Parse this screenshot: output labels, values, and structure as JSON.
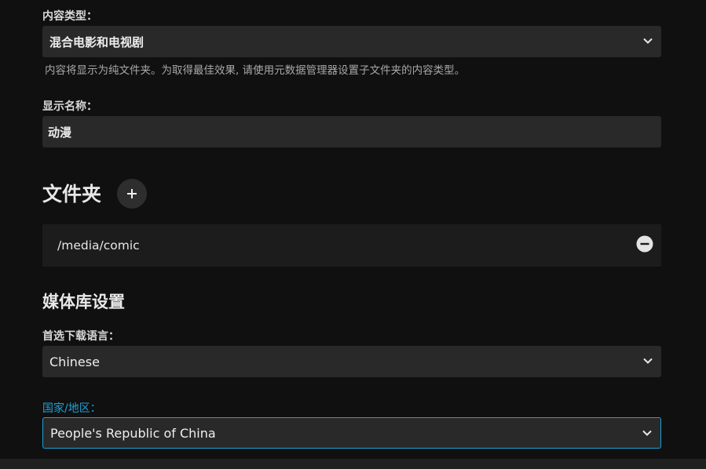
{
  "content_type": {
    "label": "内容类型：",
    "value": "混合电影和电视剧",
    "help": "内容将显示为纯文件夹。为取得最佳效果, 请使用元数据管理器设置子文件夹的内容类型。"
  },
  "display_name": {
    "label": "显示名称：",
    "value": "动漫"
  },
  "folders": {
    "title": "文件夹",
    "add_icon": "plus-icon",
    "items": [
      {
        "path": "/media/comic",
        "remove_icon": "minus-circle-icon"
      }
    ]
  },
  "library_settings": {
    "title": "媒体库设置",
    "language": {
      "label": "首选下载语言：",
      "value": "Chinese"
    },
    "country": {
      "label": "国家/地区：",
      "value": "People's Republic of China"
    }
  },
  "colors": {
    "background": "#101010",
    "field": "#292929",
    "accent": "#1ea0d8"
  }
}
